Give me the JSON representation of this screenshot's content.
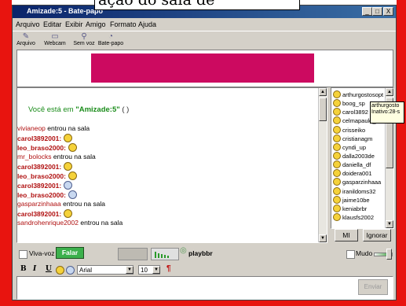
{
  "caption": "ação do sala de",
  "window": {
    "title": "Amizade:5 - Bate-papo",
    "minimize": "_",
    "maximize": "□",
    "close": "X"
  },
  "menu": [
    "Arquivo",
    "Editar",
    "Exibir",
    "Amigo",
    "Formato",
    "Ajuda"
  ],
  "toolbar": [
    {
      "label": "Arquivo",
      "icon": "paperclip-icon"
    },
    {
      "label": "Webcam",
      "icon": "webcam-icon"
    },
    {
      "label": "Sem voz",
      "icon": "microphone-mute-icon"
    },
    {
      "label": "Bate-papo",
      "icon": "chat-bubbles-icon"
    }
  ],
  "chat": {
    "welcome_prefix": "Você está em ",
    "room": "\"Amizade:5\"",
    "welcome_suffix": " ( )",
    "messages": [
      {
        "user": "vivianeop",
        "text": " entrou na sala",
        "type": "join"
      },
      {
        "user": "carol3892001:",
        "type": "emote",
        "icon": "smile"
      },
      {
        "user": "leo_braso2000:",
        "type": "emote",
        "icon": "cool"
      },
      {
        "user": "mr_bolocks",
        "text": " entrou na sala",
        "type": "join"
      },
      {
        "user": "carol3892001:",
        "type": "emote",
        "icon": "smile"
      },
      {
        "user": "leo_braso2000:",
        "type": "emote",
        "icon": "smile"
      },
      {
        "user": "carol3892001:",
        "type": "emote",
        "icon": "nerd"
      },
      {
        "user": "leo_braso2000:",
        "type": "emote",
        "icon": "nerd"
      },
      {
        "user": "gasparzinhaaa",
        "text": " entrou na sala",
        "type": "join"
      },
      {
        "user": "carol3892001:",
        "type": "emote",
        "icon": "heart"
      },
      {
        "user": "sandrohenrique2002",
        "text": " entrou na sala",
        "type": "join"
      }
    ]
  },
  "users": [
    "arthurgostosopt",
    "boog_sp",
    "carol3892",
    "celmapaulo_19",
    "crisseiko",
    "cristianagm",
    "cyndi_up",
    "dalla2003de",
    "daniella_df",
    "doidera001",
    "gasparzinhaaa",
    "iranildoms32",
    "jaime10be",
    "keniabrbr",
    "klausfs2002"
  ],
  "tooltip": {
    "line1": "arthurgosto",
    "line2": "Inativo:28-s"
  },
  "user_buttons": {
    "im": "MI",
    "ignore": "Ignorar"
  },
  "bottom": {
    "vivavoz": "Viva-voz",
    "falar": "Falar",
    "playbbr": "playbbr",
    "mudo": "Mudo"
  },
  "format": {
    "bold": "B",
    "italic": "I",
    "underline": "U",
    "font": "Arial",
    "size": "10"
  },
  "send": "Enviar",
  "colors": {
    "banner": "#cc0a60",
    "frame": "#e8140f",
    "falar": "#3cb04c"
  }
}
